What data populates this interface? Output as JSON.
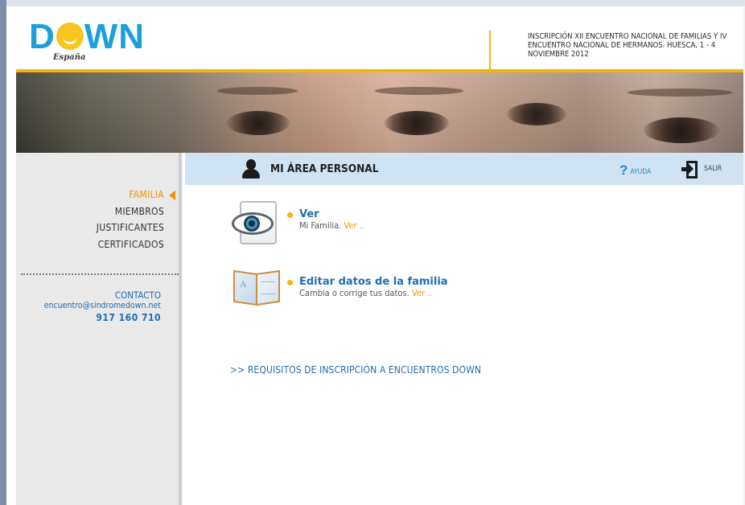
{
  "header": {
    "logo_text_left": "D",
    "logo_text_right": "WN",
    "logo_subtitle": "España",
    "event_text": "INSCRIPCIÓN XII ENCUENTRO NACIONAL DE FAMILIAS Y IV ENCUENTRO NACIONAL DE HERMANOS. HUESCA, 1 - 4 NOVIEMBRE 2012"
  },
  "sidebar": {
    "items": [
      {
        "label": "FAMILIA",
        "active": true
      },
      {
        "label": "MIEMBROS",
        "active": false
      },
      {
        "label": "JUSTIFICANTES",
        "active": false
      },
      {
        "label": "CERTIFICADOS",
        "active": false
      }
    ],
    "contact": {
      "title": "CONTACTO",
      "email": "encuentro@sindromedown.net",
      "phone": "917 160 710"
    }
  },
  "toolbar": {
    "title": "MI ÁREA PERSONAL",
    "help_glyph": "?",
    "help_label": "AYUDA",
    "logout_label": "SALIR"
  },
  "main": {
    "items": [
      {
        "title": "Ver",
        "description": "Mi Familia.",
        "link": "Ver ..",
        "icon": "view-document-icon"
      },
      {
        "title": "Editar datos de la familia",
        "description": "Cambia o corrige tus datos.",
        "link": "Ver ..",
        "icon": "open-book-icon"
      }
    ],
    "requirements_link": ">> REQUISITOS DE INSCRIPCIÓN A ENCUENTROS DOWN"
  },
  "colors": {
    "accent_orange": "#f29400",
    "accent_yellow": "#f2b705",
    "link_blue": "#1f6fb5",
    "toolbar_bg": "#cfe3f3",
    "sidebar_bg": "#e9e9e9"
  }
}
